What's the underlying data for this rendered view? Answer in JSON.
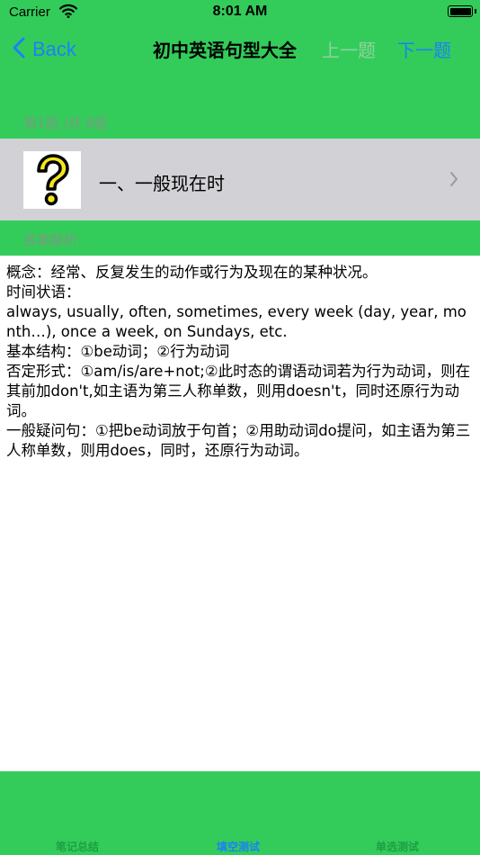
{
  "status_bar": {
    "carrier": "Carrier",
    "time": "8:01 AM"
  },
  "nav": {
    "back_label": "Back",
    "title": "初中英语句型大全",
    "prev_label": "上一题",
    "next_label": "下一题"
  },
  "progress": {
    "text": "第1题 /共 8题"
  },
  "question": {
    "title": "一、一般现在时"
  },
  "answer": {
    "header": "答案解析:",
    "body": "概念：经常、反复发生的动作或行为及现在的某种状况。\n时间状语：\nalways, usually, often, sometimes, every week (day, year, month…), once a week, on Sundays, etc.\n基本结构：①be动词；②行为动词\n否定形式：①am/is/are+not;②此时态的谓语动词若为行为动词，则在其前加don't,如主语为第三人称单数，则用doesn't，同时还原行为动词。\n一般疑问句：①把be动词放于句首；②用助动词do提问，如主语为第三人称单数，则用does，同时，还原行为动词。"
  },
  "tabs": {
    "notes": "笔记总结",
    "fill": "填空测试",
    "choice": "单选测试"
  }
}
